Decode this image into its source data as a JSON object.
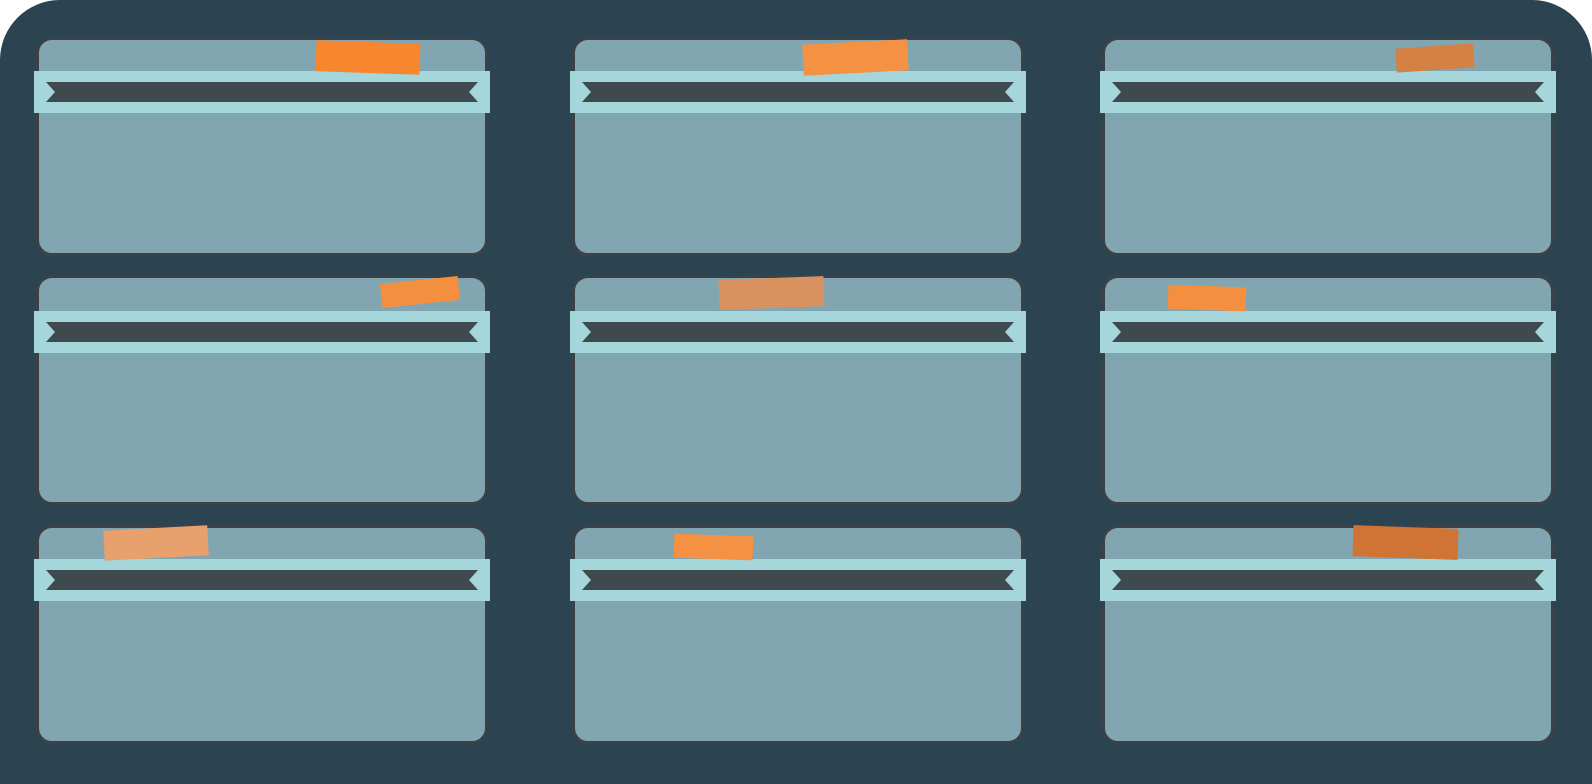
{
  "colors": {
    "board": "#2c4351",
    "drawer_fill": "#82a6b1",
    "drawer_border": "#3a4248",
    "rail_light": "#a4d6dc",
    "rail_dark": "#3f4a4e"
  },
  "drawers": [
    {
      "id": "drawer-r1-c1",
      "tape_color": "#f7862f"
    },
    {
      "id": "drawer-r1-c2",
      "tape_color": "#f49142"
    },
    {
      "id": "drawer-r1-c3",
      "tape_color": "#d38244"
    },
    {
      "id": "drawer-r2-c1",
      "tape_color": "#f48f3f"
    },
    {
      "id": "drawer-r2-c2",
      "tape_color": "#d9925f"
    },
    {
      "id": "drawer-r2-c3",
      "tape_color": "#f48f3f"
    },
    {
      "id": "drawer-r3-c1",
      "tape_color": "#e8a06c"
    },
    {
      "id": "drawer-r3-c2",
      "tape_color": "#f49142"
    },
    {
      "id": "drawer-r3-c3",
      "tape_color": "#cf7434"
    }
  ]
}
